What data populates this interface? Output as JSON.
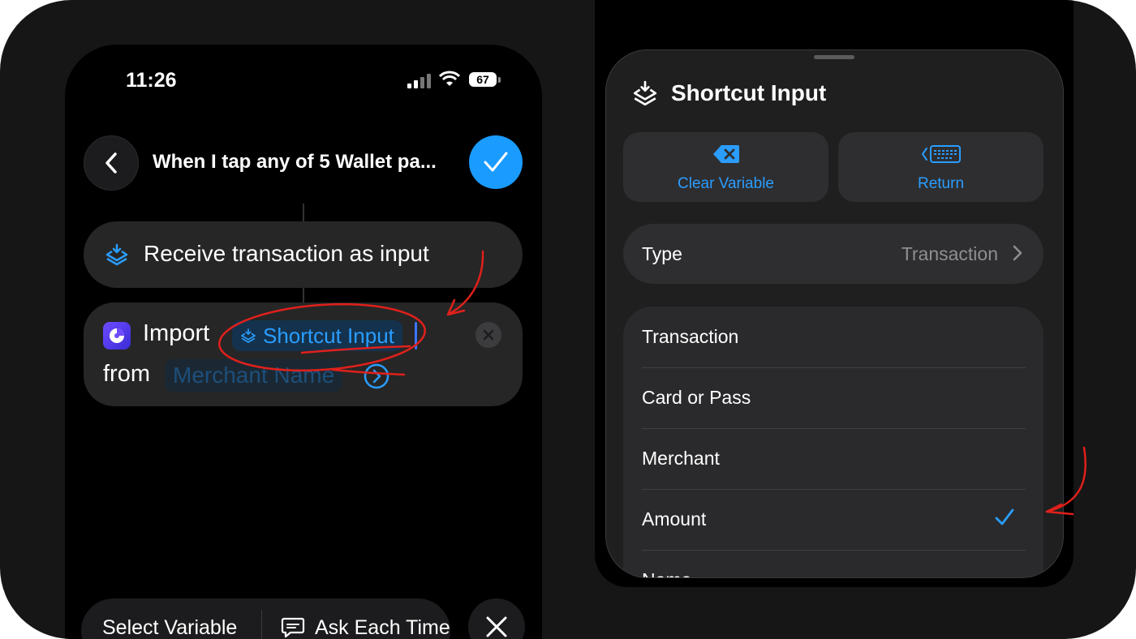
{
  "status_bar": {
    "time": "11:26",
    "battery": "67"
  },
  "editor": {
    "nav_title": "When I tap any of 5 Wallet pa...",
    "receive_label": "Receive transaction as input",
    "import_word": "Import",
    "token_label": "Shortcut Input",
    "from_word": "from",
    "placeholder": "Merchant Name"
  },
  "bottom_bar": {
    "select_variable": "Select Variable",
    "ask_each_time": "Ask Each Time"
  },
  "sheet": {
    "title": "Shortcut Input",
    "clear_variable": "Clear Variable",
    "return_label": "Return",
    "type_key": "Type",
    "type_value": "Transaction",
    "items": [
      {
        "label": "Transaction",
        "checked": false
      },
      {
        "label": "Card or Pass",
        "checked": false
      },
      {
        "label": "Merchant",
        "checked": false
      },
      {
        "label": "Amount",
        "checked": true
      },
      {
        "label": "Name",
        "checked": false
      }
    ]
  },
  "colors": {
    "accent": "#1a9bff",
    "annotation": "#e0201b",
    "background": "#000000"
  }
}
